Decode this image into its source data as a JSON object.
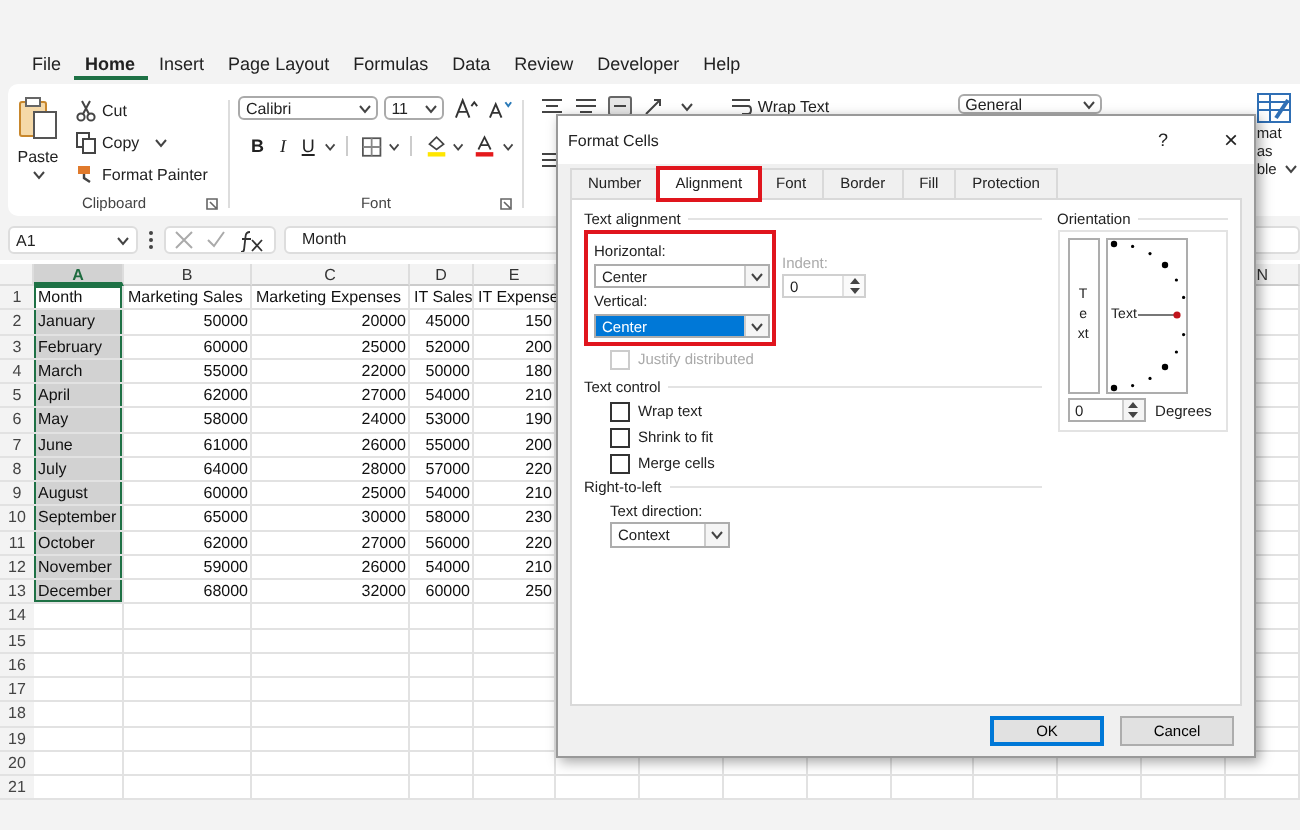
{
  "menu_tabs": [
    {
      "label": "File",
      "selected": false
    },
    {
      "label": "Home",
      "selected": true
    },
    {
      "label": "Insert",
      "selected": false
    },
    {
      "label": "Page Layout",
      "selected": false
    },
    {
      "label": "Formulas",
      "selected": false
    },
    {
      "label": "Data",
      "selected": false
    },
    {
      "label": "Review",
      "selected": false
    },
    {
      "label": "Developer",
      "selected": false
    },
    {
      "label": "Help",
      "selected": false
    }
  ],
  "ribbon": {
    "clipboard": {
      "paste": "Paste",
      "cut": "Cut",
      "copy": "Copy",
      "format_painter": "Format Painter",
      "group_label": "Clipboard"
    },
    "font": {
      "font_name": "Calibri",
      "font_size": "11",
      "bold": "B",
      "italic": "I",
      "underline": "U",
      "group_label": "Font"
    },
    "alignment": {
      "wrap_text": "Wrap Text"
    },
    "number": {
      "format": "General"
    },
    "styles": {
      "format_as_table": [
        "mat as",
        "ble"
      ]
    }
  },
  "formula_bar": {
    "name_box": "A1",
    "formula": "Month"
  },
  "sheet": {
    "columns": [
      {
        "label": "A",
        "selected": true
      },
      {
        "label": "B",
        "selected": false
      },
      {
        "label": "C",
        "selected": false
      },
      {
        "label": "D",
        "selected": false
      },
      {
        "label": "E",
        "selected": false
      }
    ],
    "right_columns": [
      {
        "label": "N",
        "selected": false
      }
    ],
    "rows": [
      {
        "num": "1",
        "kind": "header",
        "cells": [
          "Month",
          "Marketing Sales",
          "Marketing Expenses",
          "IT Sales",
          "IT Expense"
        ]
      },
      {
        "num": "2",
        "kind": "data",
        "cells": [
          "January",
          "50000",
          "20000",
          "45000",
          "150"
        ]
      },
      {
        "num": "3",
        "kind": "data",
        "cells": [
          "February",
          "60000",
          "25000",
          "52000",
          "200"
        ]
      },
      {
        "num": "4",
        "kind": "data",
        "cells": [
          "March",
          "55000",
          "22000",
          "50000",
          "180"
        ]
      },
      {
        "num": "5",
        "kind": "data",
        "cells": [
          "April",
          "62000",
          "27000",
          "54000",
          "210"
        ]
      },
      {
        "num": "6",
        "kind": "data",
        "cells": [
          "May",
          "58000",
          "24000",
          "53000",
          "190"
        ]
      },
      {
        "num": "7",
        "kind": "data",
        "cells": [
          "June",
          "61000",
          "26000",
          "55000",
          "200"
        ]
      },
      {
        "num": "8",
        "kind": "data",
        "cells": [
          "July",
          "64000",
          "28000",
          "57000",
          "220"
        ]
      },
      {
        "num": "9",
        "kind": "data",
        "cells": [
          "August",
          "60000",
          "25000",
          "54000",
          "210"
        ]
      },
      {
        "num": "10",
        "kind": "data",
        "cells": [
          "September",
          "65000",
          "30000",
          "58000",
          "230"
        ]
      },
      {
        "num": "11",
        "kind": "data",
        "cells": [
          "October",
          "62000",
          "27000",
          "56000",
          "220"
        ]
      },
      {
        "num": "12",
        "kind": "data",
        "cells": [
          "November",
          "59000",
          "26000",
          "54000",
          "210"
        ]
      },
      {
        "num": "13",
        "kind": "data",
        "cells": [
          "December",
          "68000",
          "32000",
          "60000",
          "250"
        ]
      },
      {
        "num": "14",
        "kind": "empty"
      },
      {
        "num": "15",
        "kind": "empty"
      },
      {
        "num": "16",
        "kind": "empty"
      },
      {
        "num": "17",
        "kind": "empty"
      },
      {
        "num": "18",
        "kind": "empty"
      },
      {
        "num": "19",
        "kind": "empty"
      },
      {
        "num": "20",
        "kind": "empty"
      },
      {
        "num": "21",
        "kind": "empty"
      }
    ]
  },
  "dialog": {
    "title": "Format Cells",
    "help": "?",
    "close": "×",
    "tabs": [
      {
        "label": "Number",
        "selected": false,
        "highlighted": false
      },
      {
        "label": "Alignment",
        "selected": true,
        "highlighted": true
      },
      {
        "label": "Font",
        "selected": false,
        "highlighted": false
      },
      {
        "label": "Border",
        "selected": false,
        "highlighted": false
      },
      {
        "label": "Fill",
        "selected": false,
        "highlighted": false
      },
      {
        "label": "Protection",
        "selected": false,
        "highlighted": false
      }
    ],
    "text_alignment": {
      "label": "Text alignment",
      "highlighted": true,
      "horizontal": {
        "label": "Horizontal:",
        "value": "Center",
        "focused": false
      },
      "vertical": {
        "label": "Vertical:",
        "value": "Center",
        "focused": true
      },
      "indent": {
        "label": "Indent:",
        "value": "0",
        "disabled": true
      },
      "justify_distributed": {
        "label": "Justify distributed",
        "checked": false,
        "disabled": true
      }
    },
    "text_control": {
      "label": "Text control",
      "options": [
        {
          "label": "Wrap text",
          "checked": false
        },
        {
          "label": "Shrink to fit",
          "checked": false
        },
        {
          "label": "Merge cells",
          "checked": false
        }
      ]
    },
    "right_to_left": {
      "label": "Right-to-left",
      "text_direction": {
        "label": "Text direction:",
        "value": "Context"
      }
    },
    "orientation": {
      "label": "Orientation",
      "vertical_text": "Text",
      "dial_text": "Text",
      "degrees": {
        "value": "0",
        "label": "Degrees"
      }
    },
    "buttons": [
      {
        "label": "OK",
        "default": true
      },
      {
        "label": "Cancel",
        "default": false
      }
    ]
  }
}
